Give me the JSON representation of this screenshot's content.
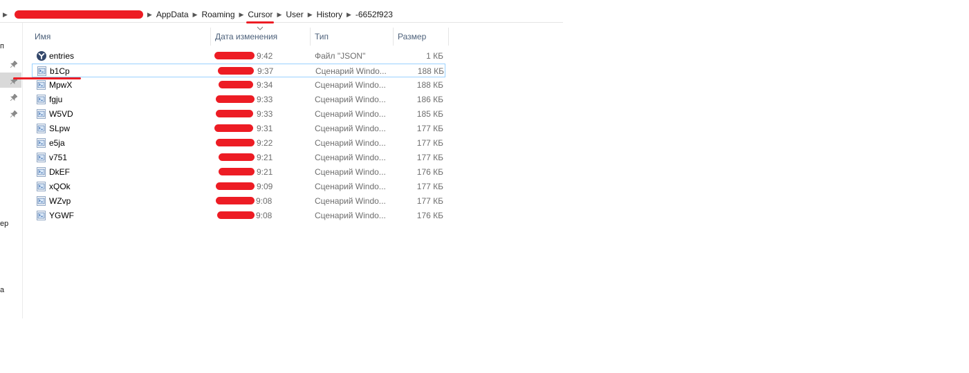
{
  "breadcrumbs": [
    "AppData",
    "Roaming",
    "Cursor",
    "User",
    "History",
    "-6652f923"
  ],
  "navpane": {
    "fragments": [
      "п",
      "ер",
      "а"
    ]
  },
  "columns": {
    "name": "Имя",
    "date": "Дата изменения",
    "type": "Тип",
    "size": "Размер"
  },
  "files": [
    {
      "name": "entries",
      "time": "9:42",
      "type": "Файл \"JSON\"",
      "size": "1 КБ",
      "icon": "cursor-app-icon"
    },
    {
      "name": "b1Cp",
      "time": "9:37",
      "type": "Сценарий Windo...",
      "size": "188 КБ",
      "icon": "script-file-icon"
    },
    {
      "name": "MpwX",
      "time": "9:34",
      "type": "Сценарий Windo...",
      "size": "188 КБ",
      "icon": "script-file-icon"
    },
    {
      "name": "fgju",
      "time": "9:33",
      "type": "Сценарий Windo...",
      "size": "186 КБ",
      "icon": "script-file-icon"
    },
    {
      "name": "W5VD",
      "time": "9:33",
      "type": "Сценарий Windo...",
      "size": "185 КБ",
      "icon": "script-file-icon"
    },
    {
      "name": "SLpw",
      "time": "9:31",
      "type": "Сценарий Windo...",
      "size": "177 КБ",
      "icon": "script-file-icon"
    },
    {
      "name": "e5ja",
      "time": "9:22",
      "type": "Сценарий Windo...",
      "size": "177 КБ",
      "icon": "script-file-icon"
    },
    {
      "name": "v751",
      "time": "9:21",
      "type": "Сценарий Windo...",
      "size": "177 КБ",
      "icon": "script-file-icon"
    },
    {
      "name": "DkEF",
      "time": "9:21",
      "type": "Сценарий Windo...",
      "size": "176 КБ",
      "icon": "script-file-icon"
    },
    {
      "name": "xQOk",
      "time": "9:09",
      "type": "Сценарий Windo...",
      "size": "177 КБ",
      "icon": "script-file-icon"
    },
    {
      "name": "WZvp",
      "time": "9:08",
      "type": "Сценарий Windo...",
      "size": "177 КБ",
      "icon": "script-file-icon"
    },
    {
      "name": "YGWF",
      "time": "9:08",
      "type": "Сценарий Windo...",
      "size": "176 КБ",
      "icon": "script-file-icon"
    }
  ],
  "colors": {
    "redaction": "#ed1c24",
    "selection_border": "#99d1ff",
    "header_text": "#4c607a",
    "meta_text": "#6d6d6d"
  }
}
